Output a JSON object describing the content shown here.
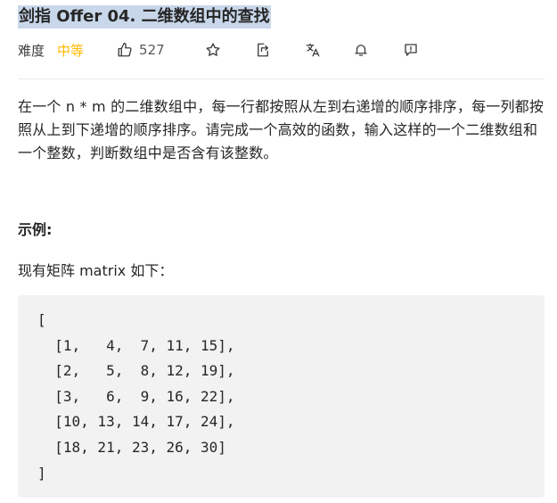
{
  "problem": {
    "title": "剑指 Offer 04. 二维数组中的查找",
    "difficulty_label": "难度",
    "difficulty_value": "中等",
    "likes": "527"
  },
  "toolbar": {
    "icons": [
      "thumbs-up-icon",
      "star-icon",
      "share-icon",
      "translate-icon",
      "bell-icon",
      "feedback-icon"
    ]
  },
  "description": "在一个 n * m 的二维数组中，每一行都按照从左到右递增的顺序排序，每一列都按照从上到下递增的顺序排序。请完成一个高效的函数，输入这样的一个二维数组和一个整数，判断数组中是否含有该整数。",
  "example": {
    "heading": "示例:",
    "intro": "现有矩阵 matrix 如下：",
    "code_lines": [
      "[",
      "  [1,   4,  7, 11, 15],",
      "  [2,   5,  8, 12, 19],",
      "  [3,   6,  9, 16, 22],",
      "  [10, 13, 14, 17, 24],",
      "  [18, 21, 23, 26, 30]",
      "]"
    ]
  },
  "colors": {
    "difficulty_medium": "#ffb800",
    "title_highlight": "#c9d7ea",
    "code_background": "#f2f2f2"
  }
}
